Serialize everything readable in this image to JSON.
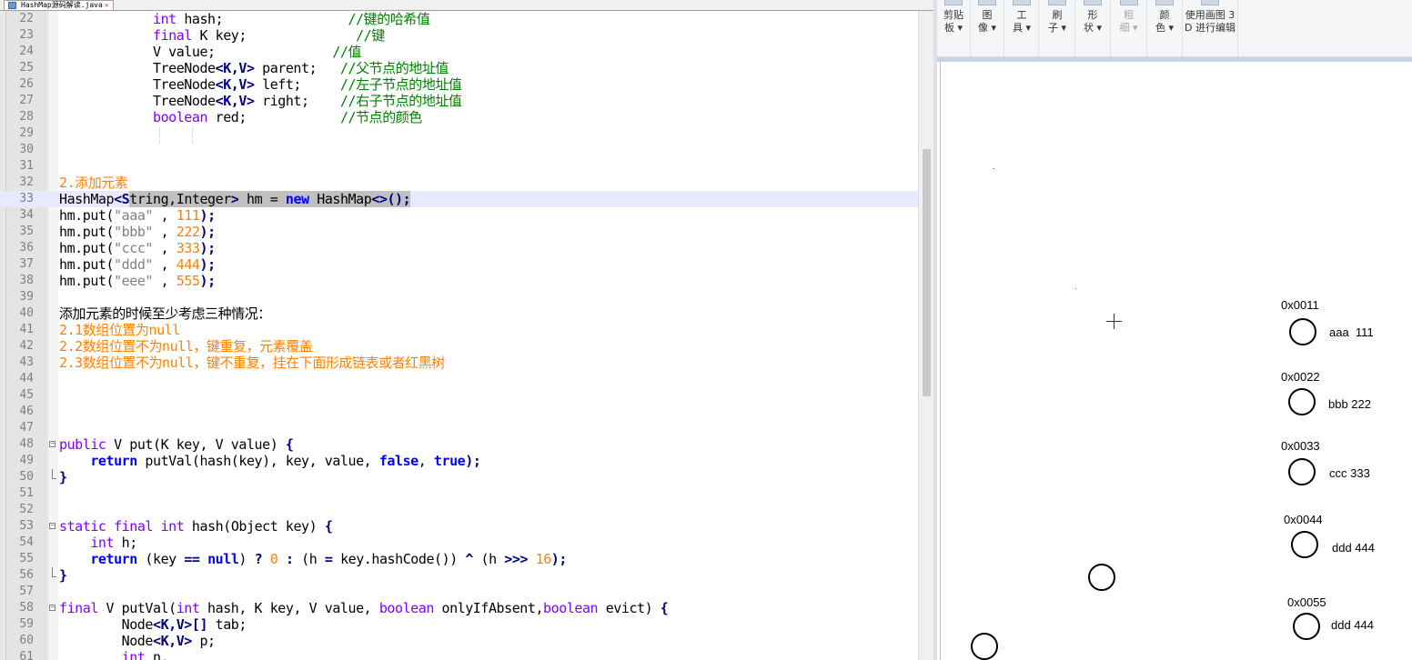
{
  "editor": {
    "tab_title": "HashMap源码解读.java",
    "tab_close": "✕"
  },
  "code_lines": [
    {
      "n": "22",
      "s": [
        [
          "            ",
          ""
        ],
        [
          "int",
          "ty"
        ],
        [
          " hash;                ",
          ""
        ],
        [
          "//键的哈希值",
          "cm"
        ]
      ]
    },
    {
      "n": "23",
      "s": [
        [
          "            ",
          ""
        ],
        [
          "final",
          "ty"
        ],
        [
          " K key;              ",
          ""
        ],
        [
          "//键",
          "cm"
        ]
      ]
    },
    {
      "n": "24",
      "s": [
        [
          "            V value;               ",
          ""
        ],
        [
          "//值",
          "cm"
        ]
      ]
    },
    {
      "n": "25",
      "s": [
        [
          "            TreeNode",
          ""
        ],
        [
          "<K,V>",
          "op"
        ],
        [
          " parent;   ",
          ""
        ],
        [
          "//父节点的地址值",
          "cm"
        ]
      ]
    },
    {
      "n": "26",
      "s": [
        [
          "            TreeNode",
          ""
        ],
        [
          "<K,V>",
          "op"
        ],
        [
          " left;     ",
          ""
        ],
        [
          "//左子节点的地址值",
          "cm"
        ]
      ]
    },
    {
      "n": "27",
      "s": [
        [
          "            TreeNode",
          ""
        ],
        [
          "<K,V>",
          "op"
        ],
        [
          " right;    ",
          ""
        ],
        [
          "//右子节点的地址值",
          "cm"
        ]
      ]
    },
    {
      "n": "28",
      "s": [
        [
          "            ",
          ""
        ],
        [
          "boolean",
          "ty"
        ],
        [
          " red;            ",
          ""
        ],
        [
          "//节点的颜色",
          "cm"
        ]
      ]
    },
    {
      "n": "29",
      "s": []
    },
    {
      "n": "30",
      "s": []
    },
    {
      "n": "31",
      "s": []
    },
    {
      "n": "32",
      "s": [
        [
          "2.添加元素",
          "orange"
        ]
      ]
    },
    {
      "n": "33",
      "hl": true,
      "s": [
        [
          "HashMap",
          ""
        ],
        [
          "<S",
          "op"
        ],
        [
          "tring,Integer",
          "sel"
        ],
        [
          ">",
          "op sel"
        ],
        [
          " hm = ",
          "sel"
        ],
        [
          "new",
          "kw-blue sel"
        ],
        [
          " HashMap",
          "sel"
        ],
        [
          "<>();",
          "op sel"
        ]
      ]
    },
    {
      "n": "34",
      "s": [
        [
          "hm.put(",
          ""
        ],
        [
          "\"aaa\"",
          "str"
        ],
        [
          " , ",
          ""
        ],
        [
          "111",
          "num"
        ],
        [
          ");",
          "op"
        ]
      ]
    },
    {
      "n": "35",
      "s": [
        [
          "hm.put(",
          ""
        ],
        [
          "\"bbb\"",
          "str"
        ],
        [
          " , ",
          ""
        ],
        [
          "222",
          "num"
        ],
        [
          ");",
          "op"
        ]
      ]
    },
    {
      "n": "36",
      "s": [
        [
          "hm.put(",
          ""
        ],
        [
          "\"ccc\"",
          "str"
        ],
        [
          " , ",
          ""
        ],
        [
          "333",
          "num"
        ],
        [
          ");",
          "op"
        ]
      ]
    },
    {
      "n": "37",
      "s": [
        [
          "hm.put(",
          ""
        ],
        [
          "\"ddd\"",
          "str"
        ],
        [
          " , ",
          ""
        ],
        [
          "444",
          "num"
        ],
        [
          ");",
          "op"
        ]
      ]
    },
    {
      "n": "38",
      "s": [
        [
          "hm.put(",
          ""
        ],
        [
          "\"eee\"",
          "str"
        ],
        [
          " , ",
          ""
        ],
        [
          "555",
          "num"
        ],
        [
          ");",
          "op"
        ]
      ]
    },
    {
      "n": "39",
      "s": []
    },
    {
      "n": "40",
      "s": [
        [
          "添加元素的时候至少考虑三种情况：",
          ""
        ]
      ]
    },
    {
      "n": "41",
      "s": [
        [
          "2.1数组位置为null",
          "orange"
        ]
      ]
    },
    {
      "n": "42",
      "s": [
        [
          "2.2数组位置不为null，键重复，元素覆盖",
          "orange"
        ]
      ]
    },
    {
      "n": "43",
      "s": [
        [
          "2.3数组位置不为null，键不重复，挂在下面形成链表或者红黑树",
          "orange"
        ]
      ]
    },
    {
      "n": "44",
      "s": []
    },
    {
      "n": "45",
      "s": []
    },
    {
      "n": "46",
      "s": []
    },
    {
      "n": "47",
      "s": []
    },
    {
      "n": "48",
      "fold": "start",
      "s": [
        [
          "public",
          "ty"
        ],
        [
          " V put(K key, V value) ",
          ""
        ],
        [
          "{",
          "op"
        ]
      ]
    },
    {
      "n": "49",
      "s": [
        [
          "    ",
          ""
        ],
        [
          "return",
          "kw-blue"
        ],
        [
          " putVal(hash(key), key, value, ",
          ""
        ],
        [
          "false",
          "kw-blue"
        ],
        [
          ", ",
          ""
        ],
        [
          "true",
          "kw-blue"
        ],
        [
          ");",
          "op"
        ]
      ]
    },
    {
      "n": "50",
      "fold": "end",
      "s": [
        [
          "}",
          "op"
        ]
      ]
    },
    {
      "n": "51",
      "s": []
    },
    {
      "n": "52",
      "s": []
    },
    {
      "n": "53",
      "fold": "start",
      "s": [
        [
          "static",
          "ty"
        ],
        [
          " ",
          ""
        ],
        [
          "final",
          "ty"
        ],
        [
          " ",
          ""
        ],
        [
          "int",
          "ty"
        ],
        [
          " hash(Object key) ",
          ""
        ],
        [
          "{",
          "op"
        ]
      ]
    },
    {
      "n": "54",
      "s": [
        [
          "    ",
          ""
        ],
        [
          "int",
          "ty"
        ],
        [
          " h;",
          ""
        ]
      ]
    },
    {
      "n": "55",
      "s": [
        [
          "    ",
          ""
        ],
        [
          "return",
          "kw-blue"
        ],
        [
          " (key ",
          ""
        ],
        [
          "==",
          "op"
        ],
        [
          " ",
          ""
        ],
        [
          "null",
          "kw-blue"
        ],
        [
          ") ",
          ""
        ],
        [
          "?",
          "op"
        ],
        [
          " ",
          ""
        ],
        [
          "0",
          "num"
        ],
        [
          " ",
          ""
        ],
        [
          ":",
          "op"
        ],
        [
          " (h ",
          ""
        ],
        [
          "=",
          "op"
        ],
        [
          " key.hashCode()) ",
          ""
        ],
        [
          "^",
          "op"
        ],
        [
          " (h ",
          ""
        ],
        [
          ">>>",
          "op"
        ],
        [
          " ",
          ""
        ],
        [
          "16",
          "num"
        ],
        [
          ");",
          "op"
        ]
      ]
    },
    {
      "n": "56",
      "fold": "end",
      "s": [
        [
          "}",
          "op"
        ]
      ]
    },
    {
      "n": "57",
      "s": []
    },
    {
      "n": "58",
      "fold": "start",
      "s": [
        [
          "final",
          "ty"
        ],
        [
          " V putVal(",
          ""
        ],
        [
          "int",
          "ty"
        ],
        [
          " hash, K key, V value, ",
          ""
        ],
        [
          "boolean",
          "ty"
        ],
        [
          " onlyIfAbsent,",
          ""
        ],
        [
          "boolean",
          "ty"
        ],
        [
          " evict) ",
          ""
        ],
        [
          "{",
          "op"
        ]
      ]
    },
    {
      "n": "59",
      "s": [
        [
          "        Node",
          ""
        ],
        [
          "<K,V>[]",
          "op"
        ],
        [
          " tab;",
          ""
        ]
      ]
    },
    {
      "n": "60",
      "s": [
        [
          "        Node",
          ""
        ],
        [
          "<K,V>",
          "op"
        ],
        [
          " p;",
          ""
        ]
      ]
    },
    {
      "n": "61",
      "s": [
        [
          "        ",
          ""
        ],
        [
          "int",
          "ty"
        ],
        [
          " n,",
          ""
        ]
      ]
    }
  ],
  "ribbon": [
    {
      "name": "ribbon-clipboard",
      "label": "剪贴\n板 ▾",
      "dim": false
    },
    {
      "name": "ribbon-image",
      "label": "图\n像 ▾",
      "dim": false
    },
    {
      "name": "ribbon-tools",
      "label": "工\n具 ▾",
      "dim": false
    },
    {
      "name": "ribbon-brushes",
      "label": "刷\n子 ▾",
      "dim": false
    },
    {
      "name": "ribbon-shapes",
      "label": "形\n状 ▾",
      "dim": false
    },
    {
      "name": "ribbon-outline",
      "label": "粗\n细 ▾",
      "dim": true
    },
    {
      "name": "ribbon-colors",
      "label": "颜\n色 ▾",
      "dim": false
    },
    {
      "name": "ribbon-paint3d",
      "label": "使用画图 3\nD 进行编辑",
      "dim": false
    }
  ],
  "canvas": {
    "nodes": [
      {
        "addr": "0x0011",
        "kv": "aaa  111"
      },
      {
        "addr": "0x0022",
        "kv": "bbb 222"
      },
      {
        "addr": "0x0033",
        "kv": "ccc 333"
      },
      {
        "addr": "0x0044",
        "kv": "ddd 444"
      },
      {
        "addr": "0x0055",
        "kv": "ddd 444"
      }
    ]
  }
}
